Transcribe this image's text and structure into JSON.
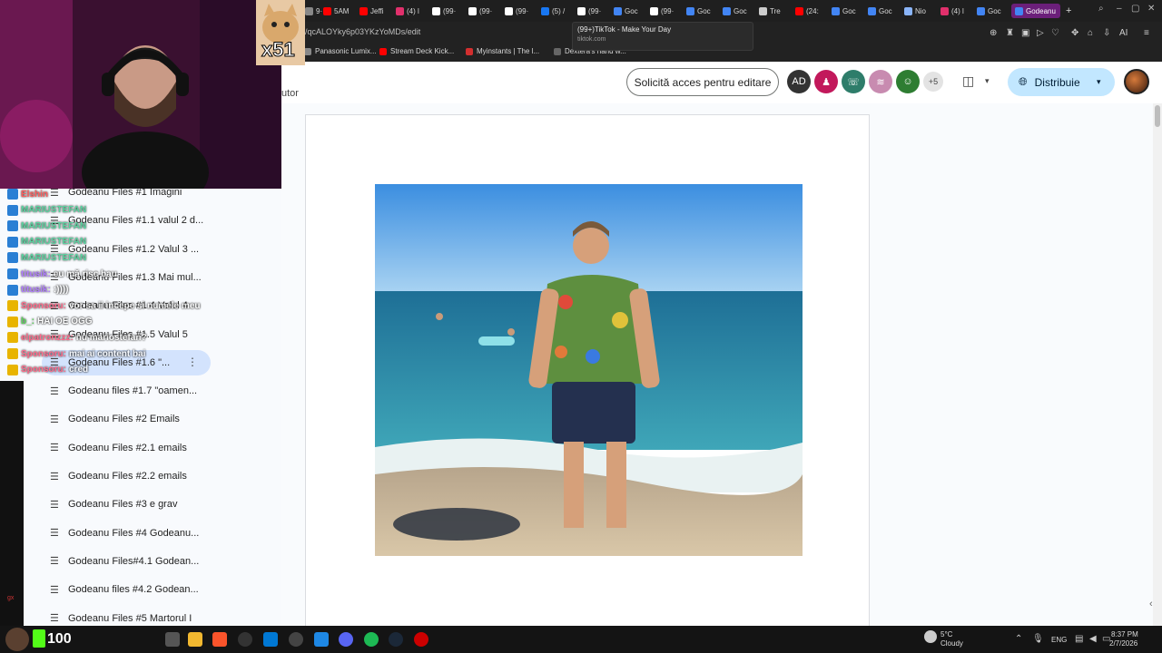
{
  "browser": {
    "tabs": [
      {
        "label": "9·",
        "color": "#888"
      },
      {
        "label": "5AM",
        "color": "#ff0000"
      },
      {
        "label": "Jeffi",
        "color": "#ff0000"
      },
      {
        "label": "(4) l",
        "color": "#e1306c"
      },
      {
        "label": "(99·",
        "color": "#ffffff"
      },
      {
        "label": "(99·",
        "color": "#ffffff"
      },
      {
        "label": "(99·",
        "color": "#ffffff"
      },
      {
        "label": "(5) /",
        "color": "#1877f2"
      },
      {
        "label": "(99·",
        "color": "#ffffff"
      },
      {
        "label": "Goc",
        "color": "#4285f4"
      },
      {
        "label": "(99·",
        "color": "#ffffff"
      },
      {
        "label": "Goc",
        "color": "#4285f4"
      },
      {
        "label": "Goc",
        "color": "#4285f4"
      },
      {
        "label": "Tre",
        "color": "#cccccc"
      },
      {
        "label": "(24:",
        "color": "#ff0000"
      },
      {
        "label": "Goc",
        "color": "#4285f4"
      },
      {
        "label": "Goc",
        "color": "#4285f4"
      },
      {
        "label": "Nio",
        "color": "#8ab4f8"
      },
      {
        "label": "(4) l",
        "color": "#e1306c"
      },
      {
        "label": "Goc",
        "color": "#4285f4"
      },
      {
        "label": "Godeanu",
        "color": "#4285f4",
        "active": true
      }
    ],
    "new_tab": "+",
    "url": "/qcALOYky6p03YKzYoMDs/edit",
    "tooltip": {
      "title": "(99+)TikTok - Make Your Day",
      "domain": "tiktok.com"
    },
    "bookmarks": [
      {
        "label": "Panasonic Lumix...",
        "color": "#888888"
      },
      {
        "label": "Stream Deck Kick...",
        "color": "#ff0000"
      },
      {
        "label": "Myinstants | The l...",
        "color": "#d32f2f"
      },
      {
        "label": "Dextera's hand w...",
        "color": "#666666"
      }
    ],
    "toolbar_ai": "AI"
  },
  "docs": {
    "author_fragment": "utor",
    "request_edit_label": "Solicită acces pentru editare",
    "viewers": [
      {
        "initials": "AD",
        "color": "#333333"
      },
      {
        "initials": "♟",
        "color": "#c2185b"
      },
      {
        "initials": "☏",
        "color": "#2e7d6a"
      },
      {
        "initials": "≋",
        "color": "#c88bb0"
      },
      {
        "initials": "☺",
        "color": "#2e7d32"
      }
    ],
    "more_viewers": "+5",
    "share_label": "Distribuie"
  },
  "outline": {
    "items": [
      "Godeanu Files #1 Imagini",
      "Godeanu Files #1.1 valul 2 d...",
      "Godeanu Files #1.2 Valul 3 ...",
      "Godeanu Files #1.3 Mai mul...",
      "Godeanu Files #1.4 Valul 4",
      "Godeanu Files #1.5 Valul 5",
      "Godeanu Files #1.6 \"...",
      "Godeanu files #1.7 \"oamen...",
      "Godeanu Files #2 Emails",
      "Godeanu Files #2.1 emails",
      "Godeanu Files #2.2 emails",
      "Godeanu Files #3 e grav",
      "Godeanu Files #4 Godeanu...",
      "Godeanu Files#4.1 Godean...",
      "Godeanu files #4.2 Godean...",
      "Godeanu Files #5 Martorul I"
    ],
    "selected_index": 6
  },
  "stream": {
    "multiplier": "x51",
    "chat": [
      {
        "user": "Elshin",
        "msg": "",
        "color": "#ff5c5c"
      },
      {
        "user": "MARIUSTEFAN",
        "msg": "",
        "color": "#5ad3a0"
      },
      {
        "user": "MARIUSTEFAN",
        "msg": "",
        "color": "#5ad3a0"
      },
      {
        "user": "MARIUSTEFAN",
        "msg": "",
        "color": "#5ad3a0"
      },
      {
        "user": "MARIUSTEFAN",
        "msg": "",
        "color": "#5ad3a0"
      },
      {
        "user": "titusik:",
        "msg": "eu mă risc bau",
        "color": "#b07cff"
      },
      {
        "user": "titusik:",
        "msg": ":))))",
        "color": "#b07cff"
      },
      {
        "user": "Sponsoru:",
        "msg": "vor sa ii incepe si numele meu",
        "color": "#ff6b8b"
      },
      {
        "user": "b_:",
        "msg": "HAI OE OGG",
        "color": "#5ad35a"
      },
      {
        "user": "elpatronzzz:",
        "msg": "nu mariostefan?",
        "color": "#ff6b8b"
      },
      {
        "user": "Sponsoru:",
        "msg": "mai ai content bai",
        "color": "#ff6b8b"
      },
      {
        "user": "Sponsoru:",
        "msg": "cred",
        "color": "#ff6b8b"
      }
    ],
    "side_text": "gx"
  },
  "taskbar": {
    "kick_count": "100",
    "weather_temp": "5°C",
    "weather_cond": "Cloudy",
    "lang": "ENG",
    "time": "8:37 PM",
    "date": "2/7/2026"
  }
}
